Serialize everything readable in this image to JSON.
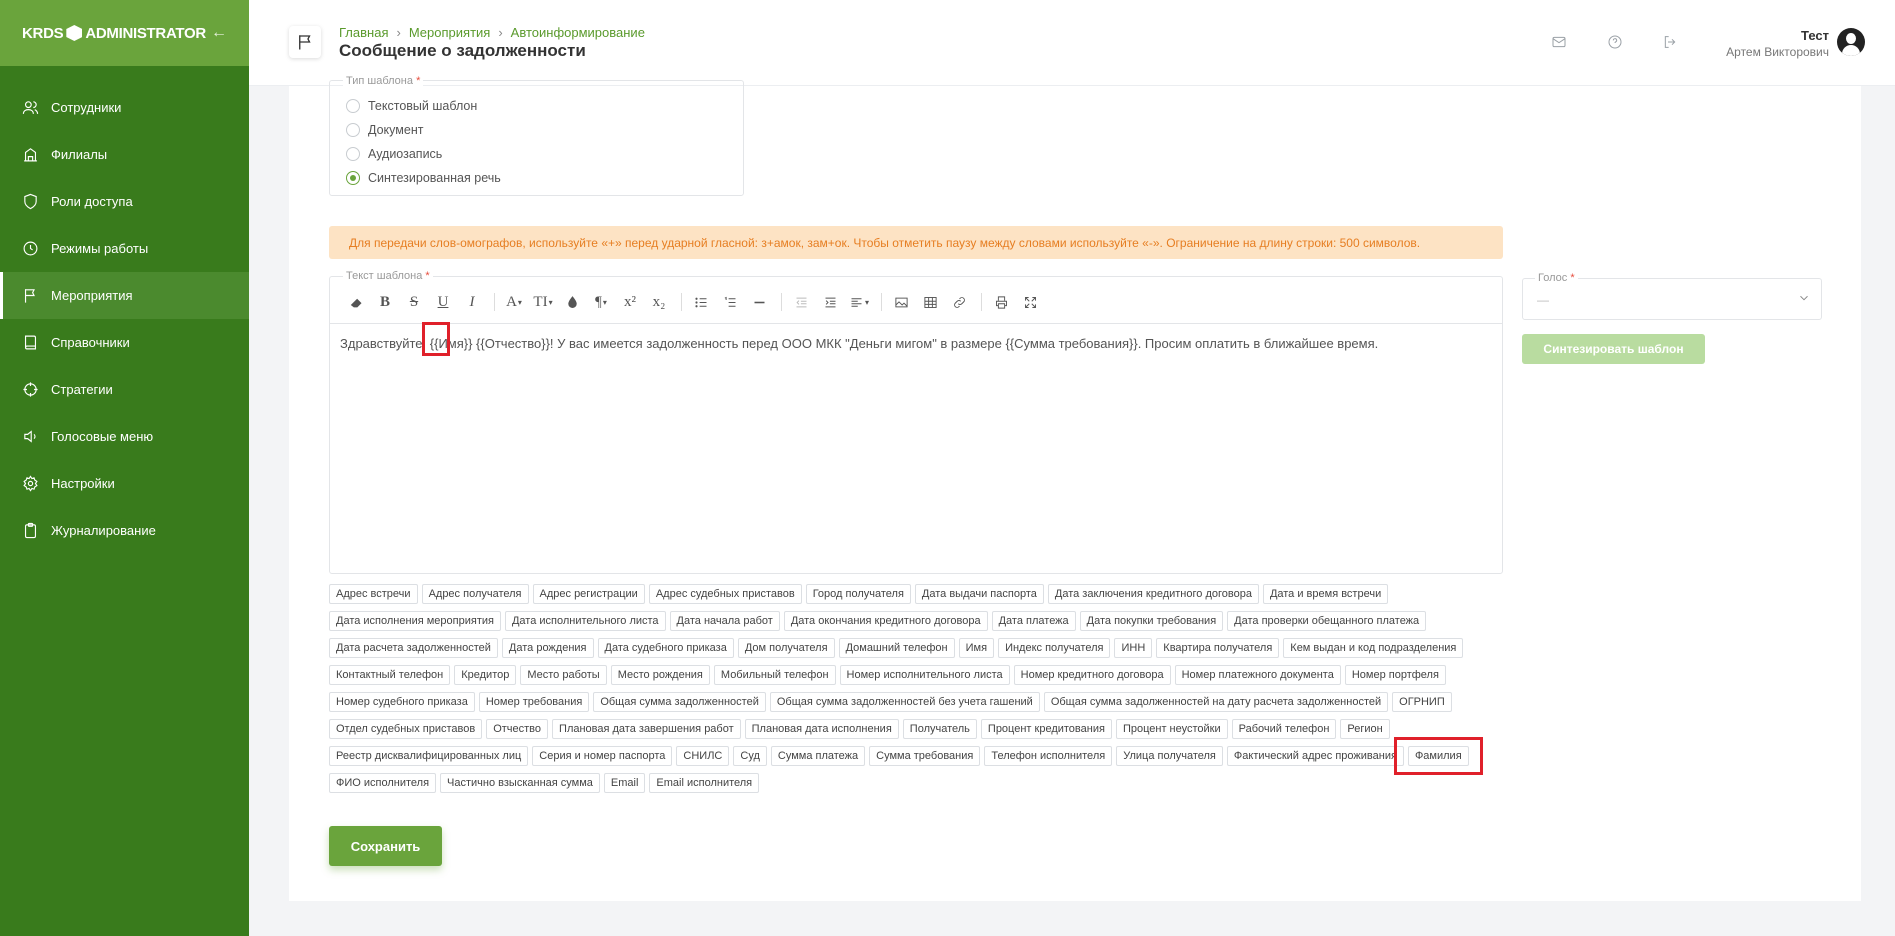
{
  "brand": {
    "logo_left": "KRDS",
    "logo_right": "ADMINISTRATOR"
  },
  "sidebar": {
    "items": [
      {
        "label": "Сотрудники",
        "icon": "users-icon"
      },
      {
        "label": "Филиалы",
        "icon": "building-icon"
      },
      {
        "label": "Роли доступа",
        "icon": "shield-icon"
      },
      {
        "label": "Режимы работы",
        "icon": "clock-icon"
      },
      {
        "label": "Мероприятия",
        "icon": "flag-icon",
        "active": true
      },
      {
        "label": "Справочники",
        "icon": "book-icon"
      },
      {
        "label": "Стратегии",
        "icon": "crosshair-icon"
      },
      {
        "label": "Голосовые меню",
        "icon": "speaker-icon"
      },
      {
        "label": "Настройки",
        "icon": "gear-icon"
      },
      {
        "label": "Журналирование",
        "icon": "clipboard-icon"
      }
    ]
  },
  "header": {
    "breadcrumbs": [
      "Главная",
      "Мероприятия",
      "Автоинформирование"
    ],
    "title": "Сообщение о задолженности",
    "user_name": "Тест",
    "user_sub": "Артем Викторович"
  },
  "template_type": {
    "legend": "Тип шаблона",
    "required": "*",
    "options": [
      {
        "label": "Текстовый шаблон",
        "selected": false
      },
      {
        "label": "Документ",
        "selected": false
      },
      {
        "label": "Аудиозапись",
        "selected": false
      },
      {
        "label": "Синтезированная речь",
        "selected": true
      }
    ]
  },
  "alert": {
    "text": "Для передачи слов-омографов, используйте «+» перед ударной гласной: з+амок, зам+ок. Чтобы отметить паузу между словами используйте «-». Ограничение на длину строки: 500 символов."
  },
  "editor": {
    "legend": "Текст шаблона",
    "required": "*",
    "content": "Здравствуйте, {{Имя}} {{Отчество}}! У вас имеется задолженность перед ООО МКК \"Деньги мигом\" в размере {{Сумма требования}}. Просим оплатить в ближайшее время."
  },
  "voice": {
    "legend": "Голос",
    "required": "*",
    "value": "—"
  },
  "synth_button": "Синтезировать шаблон",
  "save_button": "Сохранить",
  "variables": [
    "Адрес встречи",
    "Адрес получателя",
    "Адрес регистрации",
    "Адрес судебных приставов",
    "Город получателя",
    "Дата выдачи паспорта",
    "Дата заключения кредитного договора",
    "Дата и время встречи",
    "Дата исполнения мероприятия",
    "Дата исполнительного листа",
    "Дата начала работ",
    "Дата окончания кредитного договора",
    "Дата платежа",
    "Дата покупки требования",
    "Дата проверки обещанного платежа",
    "Дата расчета задолженностей",
    "Дата рождения",
    "Дата судебного приказа",
    "Дом получателя",
    "Домашний телефон",
    "Имя",
    "Индекс получателя",
    "ИНН",
    "Квартира получателя",
    "Кем выдан и код подразделения",
    "Контактный телефон",
    "Кредитор",
    "Место работы",
    "Место рождения",
    "Мобильный телефон",
    "Номер исполнительного листа",
    "Номер кредитного договора",
    "Номер платежного документа",
    "Номер портфеля",
    "Номер судебного приказа",
    "Номер требования",
    "Общая сумма задолженностей",
    "Общая сумма задолженностей без учета гашений",
    "Общая сумма задолженностей на дату расчета задолженностей",
    "ОГРНИП",
    "Отдел судебных приставов",
    "Отчество",
    "Плановая дата завершения работ",
    "Плановая дата исполнения",
    "Получатель",
    "Процент кредитования",
    "Процент неустойки",
    "Рабочий телефон",
    "Регион",
    "Реестр дисквалифицированных лиц",
    "Серия и номер паспорта",
    "СНИЛС",
    "Суд",
    "Сумма платежа",
    "Сумма требования",
    "Телефон исполнителя",
    "Улица получателя",
    "Фактический адрес проживания",
    "Фамилия",
    "ФИО исполнителя",
    "Частично взысканная сумма",
    "Email",
    "Email исполнителя"
  ],
  "colors": {
    "sidebar": "#397b1c",
    "brand": "#6aa43c",
    "accent": "#6aa43c",
    "alert_bg": "#fde3c4",
    "alert_text": "#e67e22",
    "highlight": "#e0202a"
  }
}
